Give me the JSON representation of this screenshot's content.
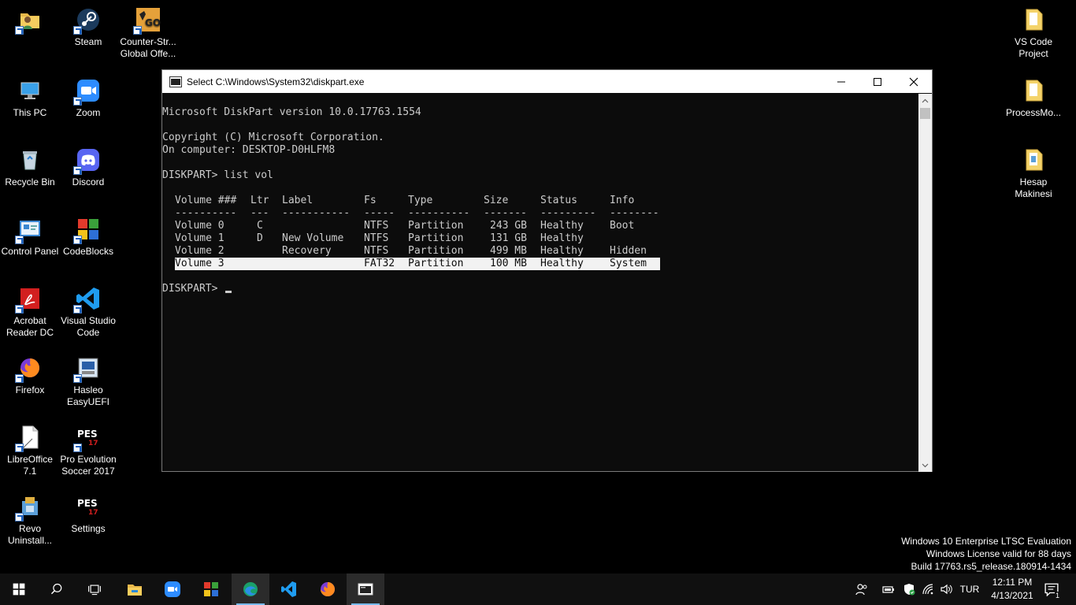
{
  "desktop": {
    "left_icons": [
      {
        "label": "",
        "icon": "user-folder-icon"
      },
      {
        "label": "Steam",
        "icon": "steam-icon"
      },
      {
        "label": "Counter-Str... Global Offe...",
        "icon": "csgo-icon"
      },
      {
        "label": "This PC",
        "icon": "this-pc-icon"
      },
      {
        "label": "Zoom",
        "icon": "zoom-icon"
      },
      {
        "label": "Recycle Bin",
        "icon": "recycle-bin-icon"
      },
      {
        "label": "Discord",
        "icon": "discord-icon"
      },
      {
        "label": "Control Panel",
        "icon": "control-panel-icon"
      },
      {
        "label": "CodeBlocks",
        "icon": "codeblocks-icon"
      },
      {
        "label": "Acrobat Reader DC",
        "icon": "acrobat-icon"
      },
      {
        "label": "Visual Studio Code",
        "icon": "vscode-icon"
      },
      {
        "label": "Firefox",
        "icon": "firefox-icon"
      },
      {
        "label": "Hasleo EasyUEFI",
        "icon": "easyuefi-icon"
      },
      {
        "label": "LibreOffice 7.1",
        "icon": "libreoffice-icon"
      },
      {
        "label": "Pro Evolution Soccer 2017",
        "icon": "pes-icon"
      },
      {
        "label": "Revo Uninstall...",
        "icon": "revo-icon"
      },
      {
        "label": "Settings",
        "icon": "pes-icon"
      }
    ],
    "right_icons": [
      {
        "label": "VS Code Project",
        "icon": "folder-icon"
      },
      {
        "label": "ProcessMo...",
        "icon": "folder-icon"
      },
      {
        "label": "Hesap Makinesi",
        "icon": "folder-icon"
      }
    ]
  },
  "console": {
    "title": "Select C:\\Windows\\System32\\diskpart.exe",
    "version_line": "Microsoft DiskPart version 10.0.17763.1554",
    "copyright_line": "Copyright (C) Microsoft Corporation.",
    "computer_line": "On computer: DESKTOP-D0HLFM8",
    "command_line": "DISKPART> list vol",
    "table": {
      "headers": [
        "Volume ###",
        "Ltr",
        "Label",
        "Fs",
        "Type",
        "Size",
        "Status",
        "Info"
      ],
      "separators": [
        "----------",
        "---",
        "-----------",
        "-----",
        "----------",
        "-------",
        "---------",
        "--------"
      ],
      "rows": [
        [
          "Volume 0",
          "C",
          "",
          "NTFS",
          "Partition",
          "243 GB",
          "Healthy",
          "Boot"
        ],
        [
          "Volume 1",
          "D",
          "New Volume",
          "NTFS",
          "Partition",
          "131 GB",
          "Healthy",
          ""
        ],
        [
          "Volume 2",
          "",
          "Recovery",
          "NTFS",
          "Partition",
          "499 MB",
          "Healthy",
          "Hidden"
        ],
        [
          "Volume 3",
          "",
          "",
          "FAT32",
          "Partition",
          "100 MB",
          "Healthy",
          "System"
        ]
      ],
      "selected_row": 3
    },
    "prompt_line": "DISKPART> "
  },
  "watermark": {
    "line1": "Windows 10 Enterprise LTSC Evaluation",
    "line2": "Windows License valid for 88 days",
    "line3": "Build 17763.rs5_release.180914-1434"
  },
  "taskbar": {
    "language": "TUR",
    "time": "12:11 PM",
    "date": "4/13/2021",
    "notification_count": "1"
  },
  "colors": {
    "console_bg": "#0c0c0c",
    "console_text": "#cccccc",
    "selection": "#f2f2f2",
    "taskbar_bg": "#101010",
    "accent": "#76b9ed"
  }
}
